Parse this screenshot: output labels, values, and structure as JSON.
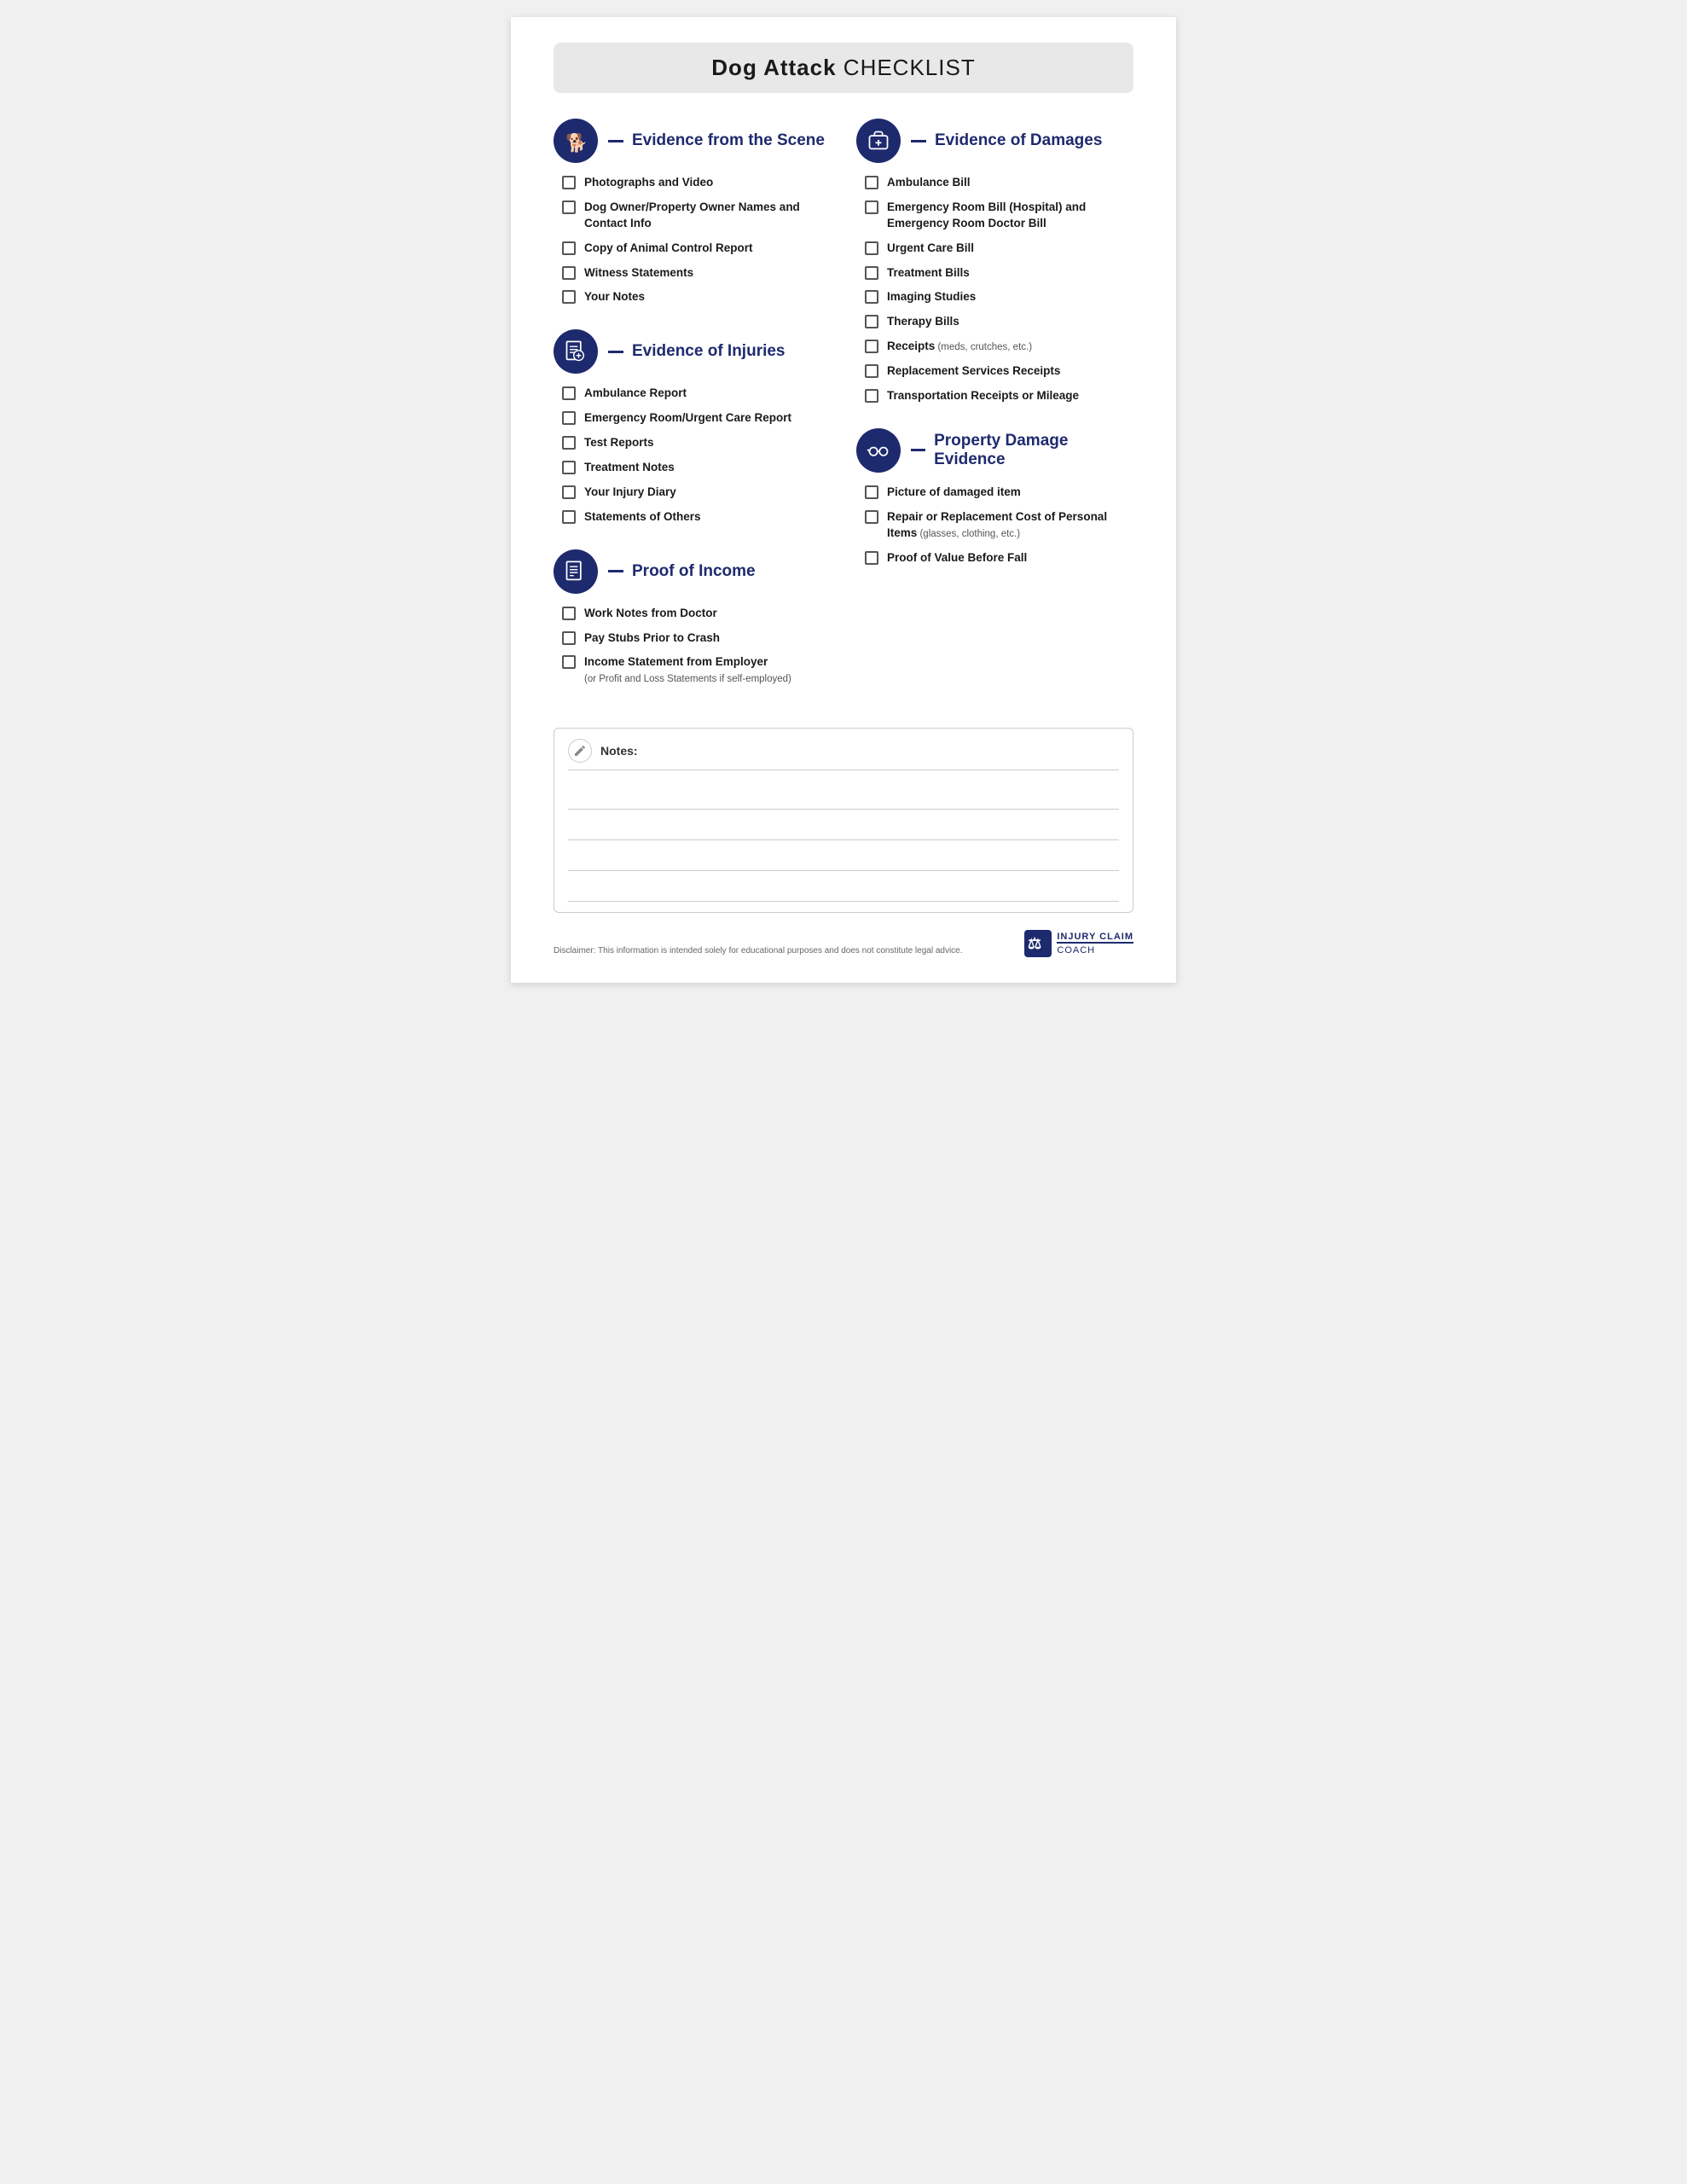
{
  "title": {
    "bold": "Dog Attack",
    "light": " CHECKLIST"
  },
  "left_sections": [
    {
      "id": "scene",
      "title_bold": "Evidence from the Scene",
      "title_normal": "",
      "icon": "scene",
      "items": [
        {
          "text": "Photographs and Video",
          "sub": ""
        },
        {
          "text": "Dog Owner/Property Owner Names and Contact Info",
          "sub": ""
        },
        {
          "text": "Copy of Animal Control Report",
          "sub": ""
        },
        {
          "text": "Witness Statements",
          "sub": ""
        },
        {
          "text": "Your Notes",
          "sub": ""
        }
      ]
    },
    {
      "id": "injuries",
      "title_bold": "Evidence of Injuries",
      "title_normal": "",
      "icon": "injuries",
      "items": [
        {
          "text": "Ambulance Report",
          "sub": ""
        },
        {
          "text": "Emergency Room/Urgent Care Report",
          "sub": ""
        },
        {
          "text": "Test Reports",
          "sub": ""
        },
        {
          "text": "Treatment Notes",
          "sub": ""
        },
        {
          "text": "Your Injury Diary",
          "sub": ""
        },
        {
          "text": "Statements of Others",
          "sub": ""
        }
      ]
    },
    {
      "id": "income",
      "title_bold": "Proof of Income",
      "title_normal": "",
      "icon": "income",
      "items": [
        {
          "text": "Work Notes from Doctor",
          "sub": ""
        },
        {
          "text": "Pay Stubs Prior to Crash",
          "sub": ""
        },
        {
          "text": "Income Statement from Employer",
          "sub": "(or Profit and Loss Statements if self-employed)"
        }
      ]
    }
  ],
  "right_sections": [
    {
      "id": "damages",
      "title_bold": "Evidence of Damages",
      "title_normal": "",
      "icon": "damages",
      "items": [
        {
          "text": "Ambulance Bill",
          "sub": ""
        },
        {
          "text": "Emergency Room Bill (Hospital) and Emergency Room Doctor Bill",
          "sub": ""
        },
        {
          "text": "Urgent Care Bill",
          "sub": ""
        },
        {
          "text": "Treatment Bills",
          "sub": ""
        },
        {
          "text": "Imaging Studies",
          "sub": ""
        },
        {
          "text": "Therapy Bills",
          "sub": ""
        },
        {
          "text": "Receipts",
          "sub": " (meds, crutches, etc.)"
        },
        {
          "text": "Replacement Services Receipts",
          "sub": ""
        },
        {
          "text": "Transportation Receipts or Mileage",
          "sub": ""
        }
      ]
    },
    {
      "id": "property",
      "title_bold": "Property Damage Evidence",
      "title_normal": "",
      "icon": "property",
      "items": [
        {
          "text": "Picture of damaged item",
          "sub": ""
        },
        {
          "text": "Repair or Replacement Cost of Personal Items",
          "sub": " (glasses, clothing, etc.)"
        },
        {
          "text": "Proof of Value Before Fall",
          "sub": ""
        }
      ]
    }
  ],
  "notes": {
    "label": "Notes:",
    "lines": 4
  },
  "footer": {
    "disclaimer": "Disclaimer: This information is intended solely for educational purposes and does not constitute legal advice.",
    "logo_line1": "INJURY CLAIM",
    "logo_line2": "COACH"
  }
}
